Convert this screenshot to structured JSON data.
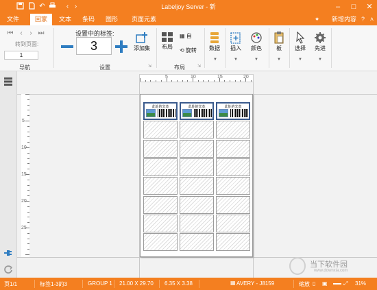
{
  "window": {
    "title": "Labeljoy Server - 新"
  },
  "menu": {
    "tabs": [
      "文件",
      "回家",
      "文本",
      "条码",
      "图形",
      "页面元素"
    ],
    "active_tab": "回家",
    "new_content": "新增内容"
  },
  "ribbon": {
    "navigation": {
      "goto_label": "转到页面:",
      "page_value": "1",
      "group_label": "导航"
    },
    "settings": {
      "set_label": "设置中的标签:",
      "count_value": "3",
      "add_set_label": "添加集",
      "group_label": "设置"
    },
    "layout": {
      "layout_label": "布局",
      "auto_label": "自",
      "rotate_label": "旋转",
      "group_label": "布局"
    },
    "data_label": "数据",
    "insert_label": "插入",
    "color_label": "颜色",
    "board_label": "板",
    "select_label": "选择",
    "advanced_label": "先进"
  },
  "ruler": {
    "h_marks": [
      "5",
      "10",
      "15",
      "20"
    ],
    "v_marks": [
      "5",
      "10",
      "15",
      "20",
      "25"
    ]
  },
  "sheet": {
    "label_text": "此处的文本",
    "filled_count": 3,
    "columns": 3,
    "rows": 8
  },
  "statusbar": {
    "page": "页1/1",
    "labels": "标签1-3的3",
    "group": "GROUP 1",
    "page_size": "21.00 X 29.70",
    "label_size": "6.35 X 3.38",
    "template": "AVERY - J8159",
    "zoom_label": "缩放",
    "zoom_value": "31%"
  },
  "watermark": {
    "text": "当下软件园",
    "url": "www.downxia.com"
  },
  "colors": {
    "brand": "#f47f20",
    "accent_blue": "#2f7dc1"
  }
}
